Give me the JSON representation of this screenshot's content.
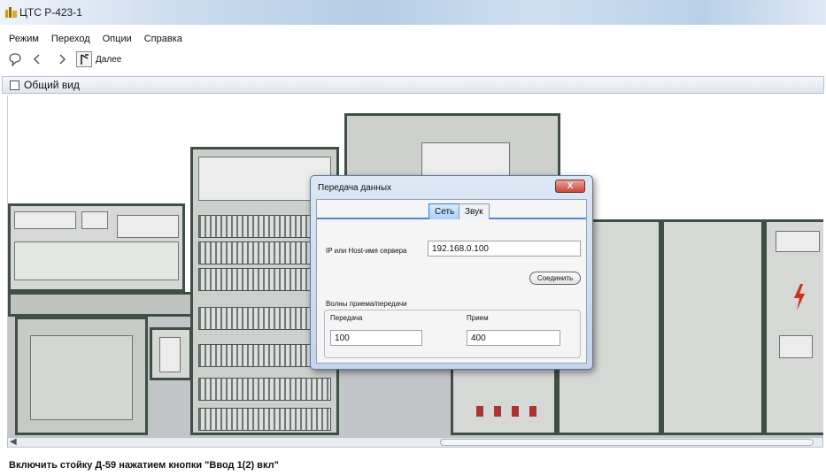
{
  "window": {
    "title": "ЦТС Р-423-1"
  },
  "menu": {
    "items": [
      "Режим",
      "Переход",
      "Опции",
      "Справка"
    ]
  },
  "toolbar": {
    "next_label": "Далее"
  },
  "panel": {
    "title": "Общий вид"
  },
  "status": {
    "text": "Включить стойку Д-59 нажатием кнопки \"Ввод 1(2) вкл\""
  },
  "dialog": {
    "title": "Передача данных",
    "close_label": "X",
    "tabs": [
      {
        "label": "Сеть",
        "active": true
      },
      {
        "label": "Звук",
        "active": false
      }
    ],
    "server_label": "IP или Host-имя сервера",
    "server_value": "192.168.0.100",
    "connect_label": "Соединить",
    "waves_label": "Волны приема/передачи",
    "transmit_label": "Передача",
    "transmit_value": "100",
    "receive_label": "Прием",
    "receive_value": "400"
  },
  "colors": {
    "accent": "#4d88d6",
    "close": "#c7463a"
  }
}
